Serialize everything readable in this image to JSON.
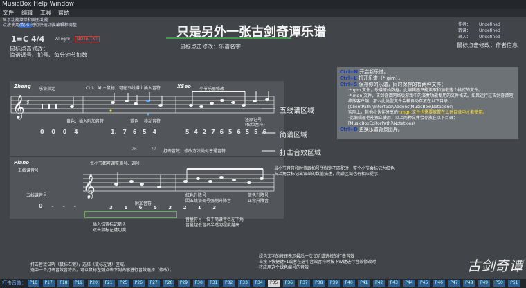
{
  "window": {
    "title": "MusicBox Help Window"
  },
  "menu": [
    "文件",
    "编辑",
    "工具",
    "帮助"
  ],
  "intro": {
    "line1": "显示功能菜单和图形功能",
    "line2a": "点按使用",
    "line2b": "(鼠标)",
    "line2c": "进行快速切换编辑和调整"
  },
  "headline": "只是另外一张古剑奇谭乐谱",
  "meta": {
    "rows": [
      {
        "label": "作者：",
        "value": "Undefined"
      },
      {
        "label": "转谱：",
        "value": "Undefined"
      },
      {
        "label": "录入：",
        "value": "Undefined"
      }
    ],
    "hint": "鼠标点击修改：作者信息"
  },
  "key": {
    "value": "1=C",
    "time": "4/4",
    "bpm": "Allegro",
    "badge": "NOTE TXT"
  },
  "key_hint": {
    "line1": "鼠标点击修改：",
    "line2": "简谱调号、拍号、每分钟节拍数"
  },
  "title_hint": "鼠标点击修改：乐谱名字",
  "sheet": {
    "zheng_label": "Zheng",
    "zheng_hint": "乐谱指定",
    "ctrl_hint": "Ctrl、Alt+鼠标，可在五线谱上插入音符",
    "xiao_label": "XSeo",
    "xiao_hint": "小节乐器修改",
    "yellow_hint": "黄色：插入附加音符",
    "blue_hint": "蓝色",
    "move_hint": "移动音符",
    "restore_hint": "还原记号\n(仅单音符)",
    "num_row_a": [
      "0",
      "0",
      "0",
      "4"
    ],
    "num_row_b": [
      "1.",
      "7",
      "6",
      "5",
      "4"
    ],
    "num_row_c": [
      "5",
      "4",
      "2",
      "7",
      "6",
      "5",
      "6",
      "5",
      "5",
      "6"
    ],
    "strike_hint": "打击音效，修改方法类似普通音符",
    "strike_nums": [
      "26",
      "27"
    ],
    "piano_label": "Piano",
    "piano_hint": "五线谱音号",
    "bar_hint": "每小节都可调整调号、调号",
    "jianpu_hint": "五线谱音号",
    "extra_hint": "附加音符",
    "sharp_red": "红色升降号",
    "sharp_red2": "因五线谱调号强制升降音",
    "sharp_blue": "蓝色升降号",
    "sharp_blue2": "正常升降音",
    "insert_hint": "插入位置标记箭头",
    "insert_hint2": "双击鼠标左键切换",
    "octave_hint": "音量符号，位于简谱音名左下角",
    "octave_hint2": "音量越低音名半透明程度越高",
    "piano_rest": [
      "0",
      "-",
      "-",
      "-"
    ],
    "piano_nums": [
      "3",
      "1",
      "6",
      "5",
      "3",
      "2",
      "1",
      "3"
    ]
  },
  "area_labels": {
    "staff": "五线谱区域",
    "jianpu": "简谱区域",
    "strike": "打击音效区域"
  },
  "red_note": {
    "line1": "当小节音符和时值跟拍号所制定不匹配时，整个小节会标记为红色",
    "line2": "右上角会标记出误差的数值描述，简谱区域也有相应提示"
  },
  "help": {
    "ctrl_n": {
      "key": "Ctrl+N",
      "text": "开启新乐谱。"
    },
    "ctrl_l": {
      "key": "Ctrl+L",
      "text": "打开乐谱（*.gjm）。"
    },
    "ctrl_s": {
      "key": "Ctrl+S",
      "text": "保存你的乐谱，同时保存的有两种文件："
    },
    "gjm": "·*.gjm 文件，乐谱原始数据。此编辑器只能读取和加载这个格式的文件。",
    "mgn": "·*.mgn 文件，古剑奇谭网络版游戏中的演奏功能专用的文件格式。如果运行过古剑奇谭网络版客户端，那么此类型文件会被自动存放在以下目录：",
    "path1": "[ClientPath]\\Interface\\Addons\\MusicBox\\Notations\\",
    "note_a": "实际上，其他小伙伴分享的",
    "note_b": "*.mgn 文件也需要放置在上述目录中才能使用。",
    "note_c": "·此编辑器也能独立使用，以上两种文件会存放在以下目录：",
    "path2": "[MusicBoxEditorPath]\\Notations\\",
    "ctrl_b": {
      "key": "Ctrl+B",
      "text": "更换乐谱背景图片。"
    }
  },
  "bottom_left": {
    "line1": "打击音效试听（鼠标右键），选择（鼠标左键）区域。",
    "line2": "选中一个打击音效音符后，可以鼠标左键点击下列内容进行音效选择（修改）。"
  },
  "bottom_right": {
    "line1": "绿色文字的按钮表示最后一次试听或选择的打击音效",
    "line2": "当按下快捷键F1或者在选中音效音符时按下W键进行音效修改时",
    "line3": "将应用这个绿色编号的音效"
  },
  "logo_text": "古剑奇谭",
  "strike_bar": {
    "label": "打击音效：",
    "keys": [
      "P16",
      "P17",
      "P18",
      "P19",
      "P20",
      "P21",
      "P25",
      "P26",
      "P27",
      "P28",
      "P29",
      "P30",
      "P31",
      "P32",
      "P33",
      "P34",
      "P35",
      "P36",
      "P37",
      "P38",
      "P39",
      "P40",
      "P41",
      "P42",
      "P43",
      "P44",
      "P45",
      "P46",
      "P47",
      "P48",
      "P49",
      "P50",
      "P51"
    ],
    "selected": "P35"
  }
}
